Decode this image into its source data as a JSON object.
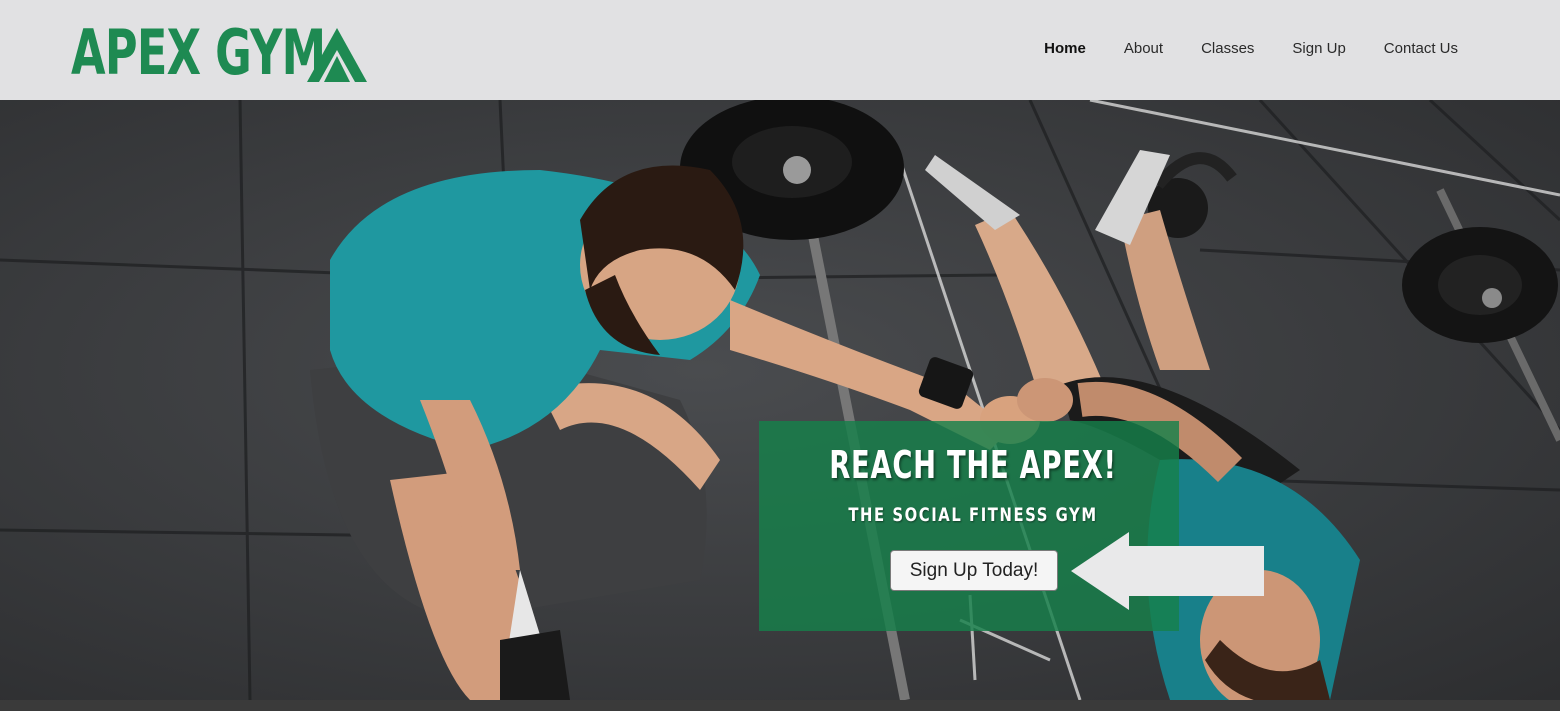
{
  "brand": {
    "name": "APEX GYM",
    "color": "#1e8a52"
  },
  "nav": {
    "items": [
      {
        "label": "Home",
        "active": true
      },
      {
        "label": "About",
        "active": false
      },
      {
        "label": "Classes",
        "active": false
      },
      {
        "label": "Sign Up",
        "active": false
      },
      {
        "label": "Contact Us",
        "active": false
      }
    ]
  },
  "hero": {
    "image": "gym-athletes-fist-bump-photo",
    "title": "REACH THE APEX!",
    "subtitle": "THE SOCIAL FITNESS GYM",
    "cta_label": "Sign Up Today!",
    "panel_color": "#16804a",
    "arrow_icon": "left-arrow-icon"
  }
}
